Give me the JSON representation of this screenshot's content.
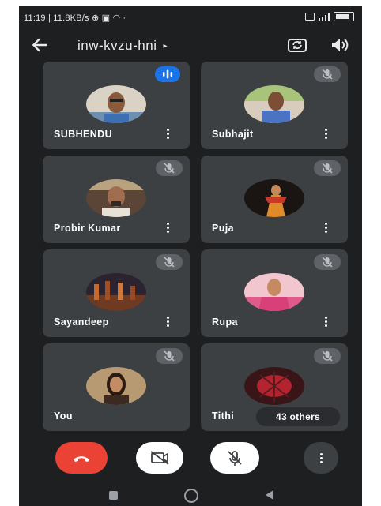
{
  "status_bar": {
    "left_text": "11:19 | 11.8KB/s ⊕ ▣ ◠ ·"
  },
  "header": {
    "meeting_code": "inw-kvzu-hni",
    "caret": "▸"
  },
  "participants": [
    {
      "name": "SUBHENDU",
      "speaking": true,
      "muted": false
    },
    {
      "name": "Subhajit",
      "speaking": false,
      "muted": true
    },
    {
      "name": "Probir Kumar",
      "speaking": false,
      "muted": true
    },
    {
      "name": "Puja",
      "speaking": false,
      "muted": true
    },
    {
      "name": "Sayandeep",
      "speaking": false,
      "muted": true
    },
    {
      "name": "Rupa",
      "speaking": false,
      "muted": true
    },
    {
      "name": "You",
      "speaking": false,
      "muted": true
    },
    {
      "name": "Tithi",
      "speaking": false,
      "muted": true
    }
  ],
  "others_pill": {
    "label": "43 others"
  },
  "controls": {
    "end_call_color": "#ea4335",
    "camera": "off",
    "microphone": "off"
  },
  "colors": {
    "background": "#1d1f21",
    "tile": "#3c4043",
    "speaking_badge": "#1a73e8",
    "mute_badge": "#5f6368"
  }
}
